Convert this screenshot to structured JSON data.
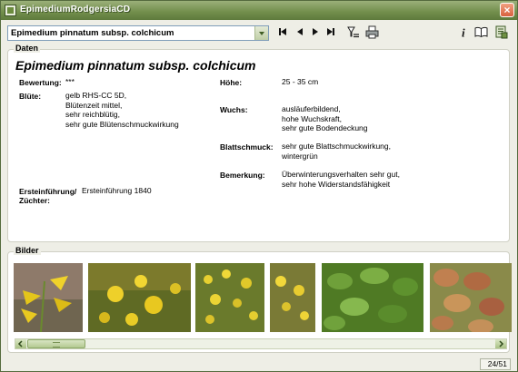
{
  "window": {
    "title": "EpimediumRodgersiaCD",
    "close_glyph": "×"
  },
  "toolbar": {
    "selected_plant": "Epimedium pinnatum subsp. colchicum",
    "icons": [
      "first-record-icon",
      "previous-record-icon",
      "next-record-icon",
      "last-record-icon",
      "filter-icon",
      "print-icon",
      "info-icon",
      "book-icon",
      "export-icon"
    ]
  },
  "daten": {
    "legend": "Daten",
    "title": "Epimedium pinnatum subsp. colchicum",
    "bewertung_label": "Bewertung:",
    "bewertung_value": "***",
    "bluete_label": "Blüte:",
    "bluete_lines": [
      "gelb RHS-CC 5D,",
      "Blütenzeit mittel,",
      "sehr reichblütig,",
      "sehr gute Blütenschmuckwirkung"
    ],
    "ersteinfuehrung_label_1": "Ersteinführung/",
    "ersteinfuehrung_label_2": "Züchter:",
    "ersteinfuehrung_value": "Ersteinführung 1840",
    "hoehe_label": "Höhe:",
    "hoehe_value": "25 - 35 cm",
    "wuchs_label": "Wuchs:",
    "wuchs_lines": [
      "ausläuferbildend,",
      "hohe Wuchskraft,",
      "sehr gute Bodendeckung"
    ],
    "blattschmuck_label": "Blattschmuck:",
    "blattschmuck_lines": [
      "sehr gute Blattschmuckwirkung,",
      "wintergrün"
    ],
    "bemerkung_label": "Bemerkung:",
    "bemerkung_lines": [
      "Überwinterungsverhalten sehr gut,",
      "sehr hohe Widerstandsfähigkeit"
    ]
  },
  "bilder": {
    "legend": "Bilder",
    "photos": [
      "flower-closeup-photo",
      "yellow-flowers-photo",
      "flower-cluster-photo",
      "flowers-on-stems-photo",
      "foliage-photo",
      "red-tinted-leaves-photo"
    ]
  },
  "status": {
    "record_position": "24/51"
  }
}
